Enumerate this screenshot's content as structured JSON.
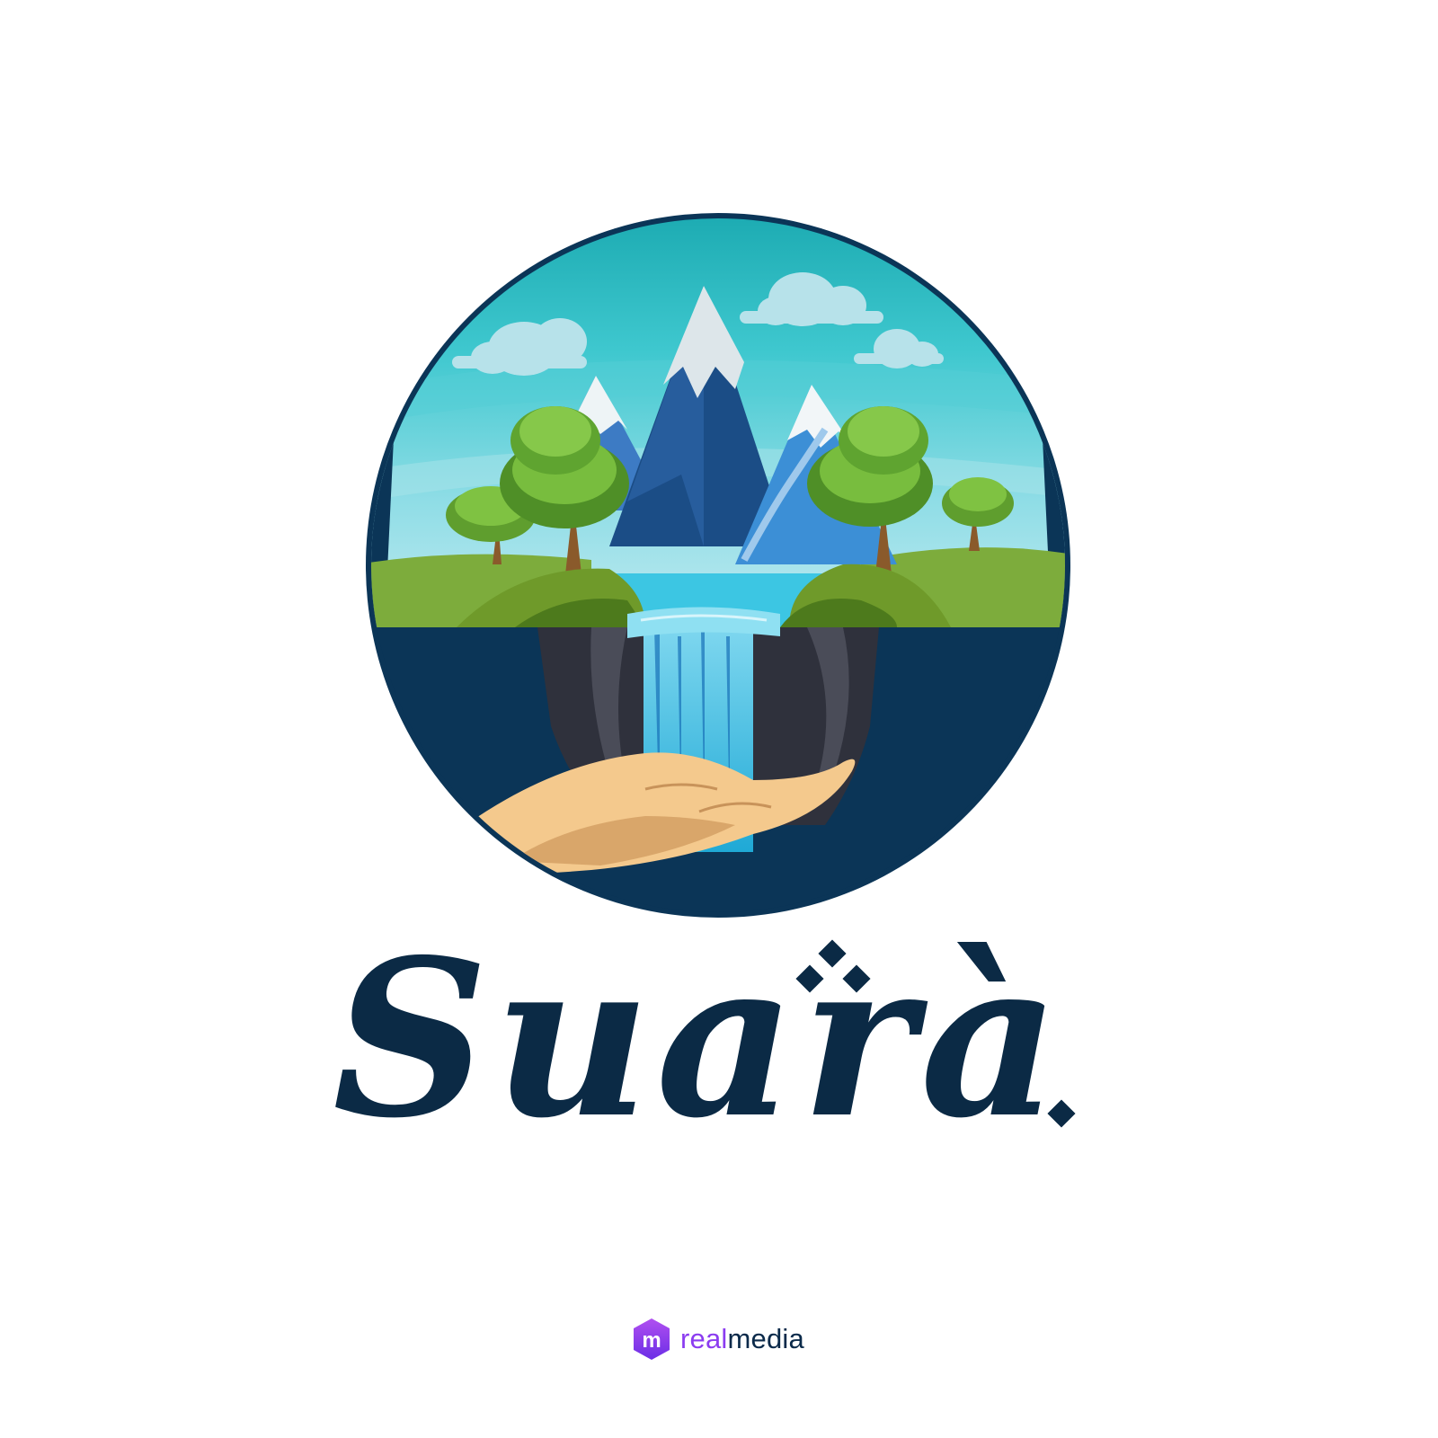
{
  "brand": {
    "name": "Suarà",
    "colors": {
      "navy": "#0b3557",
      "teal": "#1fb3b8",
      "sky": "#6fd6e0",
      "grass": "#7dac3c",
      "water": "#28bde0",
      "rock": "#3d3f4a",
      "skin": "#f4c98d",
      "snow": "#e6eef2",
      "mountain": "#1b4d86"
    },
    "emblem_elements": [
      "sky-with-clouds",
      "snow-capped-mountains",
      "trees",
      "lake",
      "waterfall",
      "cliff",
      "open-hand"
    ]
  },
  "credit": {
    "logo_letter": "m",
    "prefix": "real",
    "suffix": "media",
    "colors": {
      "logo_top": "#b04ff0",
      "logo_bottom": "#6b2ee6",
      "prefix": "#8b3cf0",
      "suffix": "#0b2a4a"
    }
  }
}
